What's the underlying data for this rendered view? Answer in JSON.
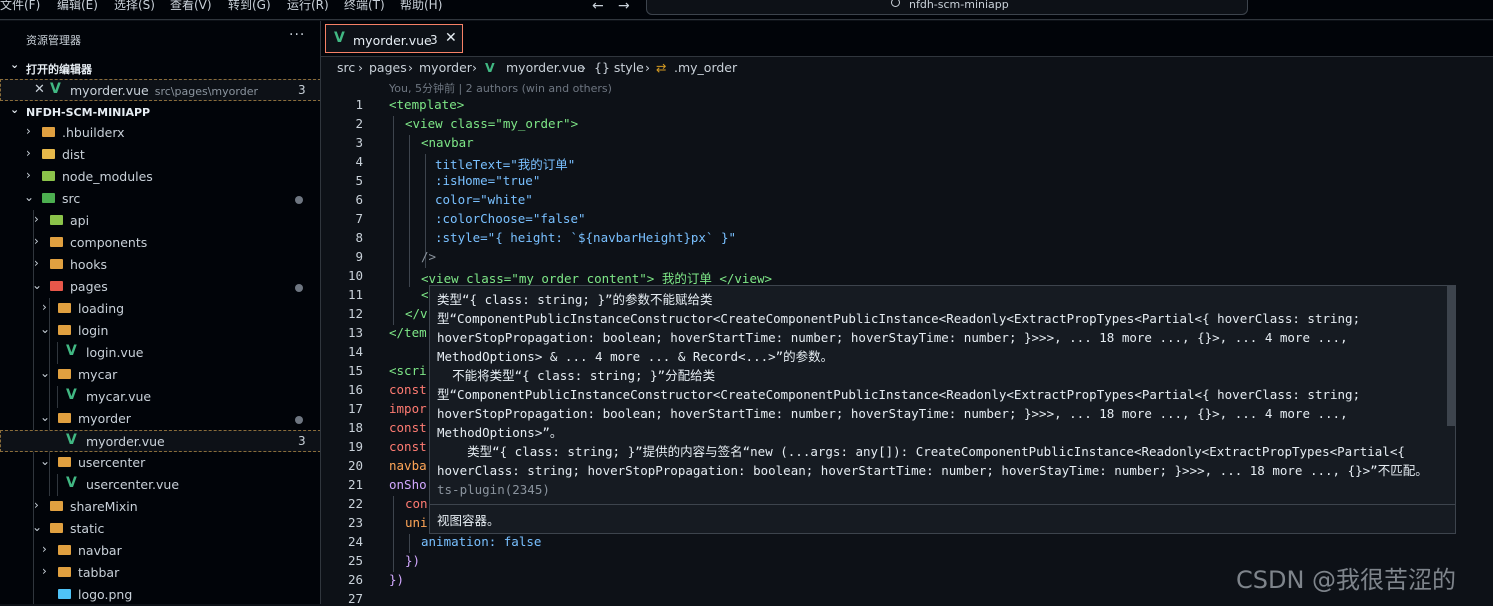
{
  "menu": [
    "文件(F)",
    "编辑(E)",
    "选择(S)",
    "查看(V)",
    "转到(G)",
    "运行(R)",
    "终端(T)",
    "帮助(H)"
  ],
  "command_center": {
    "text": "nfdh-scm-miniapp"
  },
  "sidebar": {
    "title": "资源管理器",
    "more": "···",
    "open_editors": {
      "title": "打开的编辑器",
      "items": [
        {
          "label": "myorder.vue",
          "path": "src\\pages\\myorder",
          "count": "3"
        }
      ]
    },
    "project": {
      "title": "NFDH-SCM-MINIAPP",
      "tree": [
        {
          "label": ".hbuilderx"
        },
        {
          "label": "dist"
        },
        {
          "label": "node_modules"
        },
        {
          "label": "src"
        },
        {
          "label": "api"
        },
        {
          "label": "components"
        },
        {
          "label": "hooks"
        },
        {
          "label": "pages"
        },
        {
          "label": "loading"
        },
        {
          "label": "login"
        },
        {
          "label": "login.vue"
        },
        {
          "label": "mycar"
        },
        {
          "label": "mycar.vue"
        },
        {
          "label": "myorder"
        },
        {
          "label": "myorder.vue",
          "count": "3"
        },
        {
          "label": "usercenter"
        },
        {
          "label": "usercenter.vue"
        },
        {
          "label": "shareMixin"
        },
        {
          "label": "static"
        },
        {
          "label": "navbar"
        },
        {
          "label": "tabbar"
        },
        {
          "label": "logo.png"
        }
      ]
    }
  },
  "tab": {
    "label": "myorder.vue",
    "count": "3"
  },
  "breadcrumb": [
    "src",
    "pages",
    "myorder",
    "myorder.vue",
    "{} style",
    ".my_order"
  ],
  "editor": {
    "blame": "You, 5分钟前 | 2 authors (win and others)",
    "line_numbers": [
      "1",
      "2",
      "3",
      "4",
      "5",
      "6",
      "7",
      "8",
      "9",
      "10",
      "11",
      "12",
      "13",
      "14",
      "15",
      "16",
      "17",
      "18",
      "19",
      "20",
      "21",
      "22",
      "23",
      "24",
      "25",
      "26",
      "27"
    ],
    "code_text": {
      "l1": "<template>",
      "l2": "<view class=\"my_order\">",
      "l3": "<navbar",
      "l4": "titleText=\"我的订单\"",
      "l5": ":isHome=\"true\"",
      "l6": "color=\"white\"",
      "l7": ":colorChoose=\"false\"",
      "l8": ":style=\"{ height: `${navbarHeight}px` }\"",
      "l9": "/>",
      "l10": "<view class=\"my_order_content\"> 我的订单 </view>",
      "l11": "<",
      "l12": "</v",
      "l13": "</tem",
      "l15": "<scri",
      "l16": "const",
      "l17": "impor",
      "l18": "const",
      "l19": "const",
      "l20": "navba",
      "l21": "onSho",
      "l22": "con",
      "l23": "uni",
      "l24": "animation: false",
      "l25": "})",
      "l26": "})"
    }
  },
  "hover": {
    "message": "类型“{ class: string; }”的参数不能赋给类型“ComponentPublicInstanceConstructor<CreateComponentPublicInstance<Readonly<ExtractPropTypes<Partial<{ hoverClass: string; hoverStopPropagation: boolean; hoverStartTime: number; hoverStayTime: number; }>>>, ... 18 more ..., {}>, ... 4 more ..., MethodOptions> & ... 4 more ... & Record<...>”的参数。\n  不能将类型“{ class: string; }”分配给类型“ComponentPublicInstanceConstructor<CreateComponentPublicInstance<Readonly<ExtractPropTypes<Partial<{ hoverClass: string; hoverStopPropagation: boolean; hoverStartTime: number; hoverStayTime: number; }>>>, ... 18 more ..., {}>, ... 4 more ..., MethodOptions>”。\n    类型“{ class: string; }”提供的内容与签名“new (...args: any[]): CreateComponentPublicInstance<Readonly<ExtractPropTypes<Partial<{ hoverClass: string; hoverStopPropagation: boolean; hoverStartTime: number; hoverStayTime: number; }>>>, ... 18 more ..., {}>”不匹配。",
    "source": "ts-plugin(2345)",
    "doc": "视图容器。"
  },
  "watermark": "CSDN @我很苦涩的"
}
